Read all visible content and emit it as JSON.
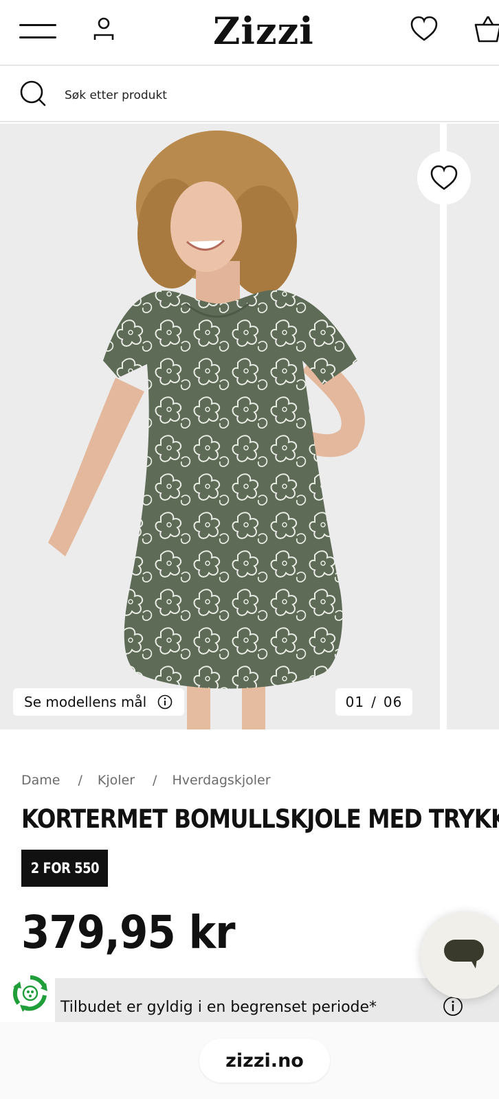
{
  "header": {
    "logo": "Zizzi",
    "menu_icon": "hamburger-menu-icon",
    "account_icon": "user-icon",
    "wishlist_icon": "heart-icon",
    "bag_icon": "shopping-bag-icon"
  },
  "search": {
    "placeholder": "Søk etter produkt",
    "icon": "search-icon"
  },
  "gallery": {
    "measures_label": "Se modellens mål",
    "current_index": "01",
    "separator": "/",
    "total": "06",
    "favorite_icon": "heart-icon"
  },
  "breadcrumb": {
    "items": [
      "Dame",
      "Kjoler",
      "Hverdagskjoler"
    ],
    "separator": "/"
  },
  "product": {
    "title": "KORTERMET BOMULLSKJOLE MED TRYKK",
    "badge": "2 FOR 550",
    "price": "379,95 kr",
    "offer_text": "Tilbudet er gyldig i en begrenset periode*"
  },
  "browser": {
    "url": "zizzi.no"
  },
  "colors": {
    "text": "#111111",
    "muted": "#6b6b6b",
    "badge_bg": "#111111",
    "offer_bg": "#e9e9e9",
    "eco_green": "#1f9e3a",
    "dress_green": "#5e6b56"
  }
}
